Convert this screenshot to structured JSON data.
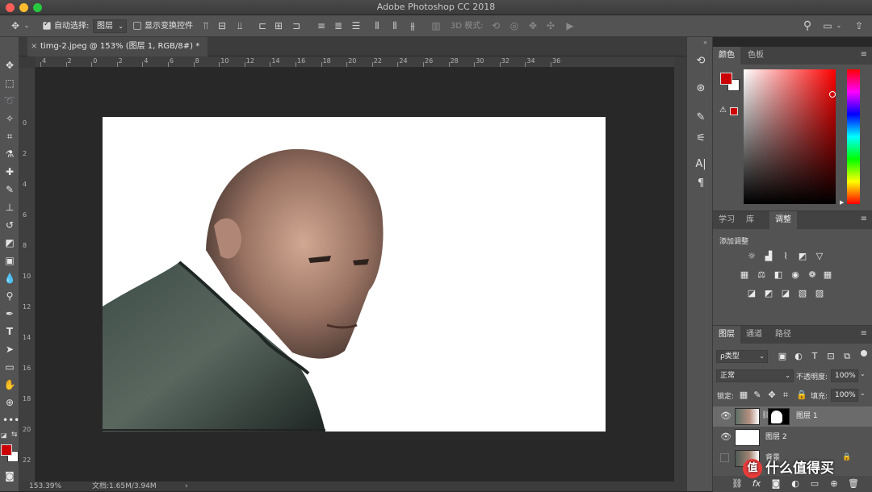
{
  "app": {
    "title": "Adobe Photoshop CC 2018"
  },
  "colors": {
    "fg": "#cc0000",
    "bg": "#ffffff"
  },
  "options": {
    "auto_select_label": "自动选择:",
    "auto_select_target": "图层",
    "show_transform_label": "显示变换控件",
    "mode_3d_label": "3D 模式:"
  },
  "document": {
    "tab_label": "timg-2.jpeg @ 153% (图层 1, RGB/8#) *",
    "tab_close": "×"
  },
  "rulers": {
    "h": [
      "4",
      "2",
      "0",
      "2",
      "4",
      "6",
      "8",
      "10",
      "12",
      "14",
      "16",
      "18",
      "20",
      "22",
      "24",
      "26",
      "28",
      "30",
      "32",
      "34",
      "36"
    ],
    "v": [
      "0",
      "2",
      "4",
      "6",
      "8",
      "10",
      "12",
      "14",
      "16",
      "18",
      "20",
      "22"
    ]
  },
  "status": {
    "zoom": "153.39%",
    "doc_size": "文档:1.65M/3.94M",
    "arrow": "›"
  },
  "color_panel": {
    "tabs": [
      "颜色",
      "色板"
    ]
  },
  "adjust_panel": {
    "tabs": [
      "学习",
      "库",
      "调整"
    ],
    "add_label": "添加调整",
    "rows": [
      [
        "brightness-icon",
        "levels-icon",
        "curves-icon",
        "exposure-icon",
        "vibrance-icon"
      ],
      [
        "huesat-icon",
        "colorbalance-icon",
        "bw-icon",
        "photofilter-icon",
        "channelmixer-icon",
        "lookup-icon"
      ],
      [
        "invert-icon",
        "posterize-icon",
        "threshold-icon",
        "selectivecolor-icon",
        "gradientmap-icon"
      ]
    ]
  },
  "layers_panel": {
    "tabs": [
      "图层",
      "通道",
      "路径"
    ],
    "filter_kind": "ρ类型",
    "blend_mode": "正常",
    "opacity_label": "不透明度:",
    "opacity_value": "100%",
    "lock_label": "锁定:",
    "fill_label": "填充:",
    "fill_value": "100%",
    "layers": [
      {
        "name": "图层 1",
        "visible": true,
        "selected": true
      },
      {
        "name": "图层 2",
        "visible": true,
        "selected": false
      },
      {
        "name": "背景",
        "visible": false,
        "selected": false,
        "locked": true
      }
    ],
    "footer_icons": [
      "link-icon",
      "fx-icon",
      "mask-icon",
      "adjustment-layer-icon",
      "group-icon",
      "new-layer-icon",
      "trash-icon"
    ]
  },
  "watermark": "值 什么值得买"
}
